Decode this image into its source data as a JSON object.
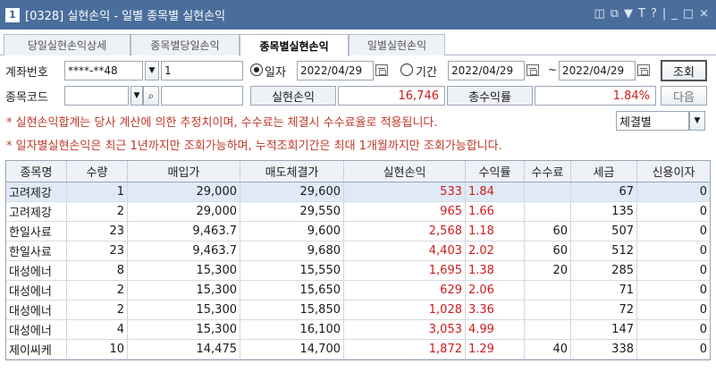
{
  "window": {
    "number": "1",
    "title": "[0328] 실현손익 - 일별 종목별 실현손익",
    "icons": [
      "layout-icon",
      "copy-icon",
      "pin-icon",
      "font-icon",
      "help-icon",
      "minimize-icon",
      "maximize-icon",
      "close-icon"
    ]
  },
  "tabs": [
    {
      "label": "당일실현손익상세"
    },
    {
      "label": "종목별당일손익"
    },
    {
      "label": "종목별실현손익"
    },
    {
      "label": "일별실현손익"
    }
  ],
  "form": {
    "account_label": "계좌번호",
    "account_value": "****-**48",
    "account_sub": "1",
    "date_radio_label": "일자",
    "date_value": "2022/04/29",
    "period_radio_label": "기간",
    "period_from": "2022/04/29",
    "period_sep": "~",
    "period_to": "2022/04/29",
    "search_button": "조회",
    "code_label": "종목코드",
    "realized_label": "실현손익",
    "realized_value": "16,746",
    "total_return_label": "총수익률",
    "total_return_value": "1.84%",
    "next_button": "다음",
    "filter_value": "체결별"
  },
  "notices": [
    "* 실현손익합계는 당사 계산에 의한 추정치이며, 수수료는 체결시 수수료율로 적용됩니다.",
    "* 일자별실현손익은 최근 1년까지만 조회가능하며, 누적조회기간은 최대 1개월까지만 조회가능합니다."
  ],
  "table": {
    "columns": [
      "종목명",
      "수량",
      "매입가",
      "매도체결가",
      "실현손익",
      "수익률",
      "수수료",
      "세금",
      "신용이자"
    ],
    "rows": [
      [
        "고려제강",
        "1",
        "29,000",
        "29,600",
        "533",
        "1.84",
        "",
        "67",
        "0"
      ],
      [
        "고려제강",
        "2",
        "29,000",
        "29,550",
        "965",
        "1.66",
        "",
        "135",
        "0"
      ],
      [
        "한일사료",
        "23",
        "9,463.7",
        "9,600",
        "2,568",
        "1.18",
        "60",
        "507",
        "0"
      ],
      [
        "한일사료",
        "23",
        "9,463.7",
        "9,680",
        "4,403",
        "2.02",
        "60",
        "512",
        "0"
      ],
      [
        "대성에너",
        "8",
        "15,300",
        "15,550",
        "1,695",
        "1.38",
        "20",
        "285",
        "0"
      ],
      [
        "대성에너",
        "2",
        "15,300",
        "15,650",
        "629",
        "2.06",
        "",
        "71",
        "0"
      ],
      [
        "대성에너",
        "2",
        "15,300",
        "15,850",
        "1,028",
        "3.36",
        "",
        "72",
        "0"
      ],
      [
        "대성에너",
        "4",
        "15,300",
        "16,100",
        "3,053",
        "4.99",
        "",
        "147",
        "0"
      ],
      [
        "제이씨케",
        "10",
        "14,475",
        "14,700",
        "1,872",
        "1.29",
        "40",
        "338",
        "0"
      ]
    ]
  },
  "colors": {
    "titlebar": "#4a6e9c",
    "profit": "#d01c1c",
    "selected_row": "#dfeaf6"
  }
}
